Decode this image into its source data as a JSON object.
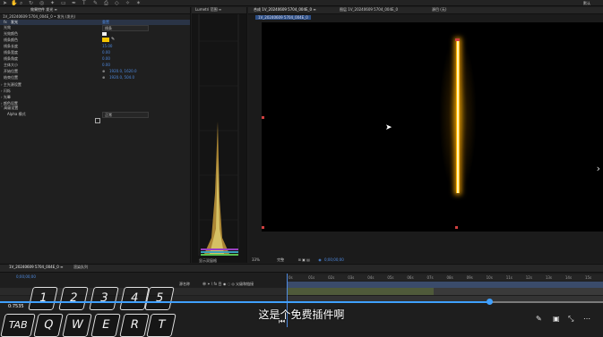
{
  "toolbar": {
    "right_label": "默认"
  },
  "effect_controls": {
    "tab_label": "效果控件 发光 ≡",
    "layer_path": "1V_20240609 5704_004E_0 • 发光 (发光)",
    "effect_name": "发光",
    "reset_label": "重置",
    "properties": [
      {
        "label": "光效",
        "value": "线条"
      },
      {
        "label": "光效颜色",
        "value": ""
      },
      {
        "label": "线条颜色",
        "value": ""
      },
      {
        "label": "线条长度",
        "value": "15.00"
      },
      {
        "label": "线条宽度",
        "value": "0.00"
      },
      {
        "label": "线条角度",
        "value": "0.00"
      },
      {
        "label": "主体大小",
        "value": "0.00"
      },
      {
        "label": "开始位置",
        "value": "1920.0, 1620.0"
      },
      {
        "label": "结束位置",
        "value": "1920.0, 504.0"
      }
    ],
    "groups": [
      "主光源设置",
      "闪烁",
      "光晕",
      "颜色设置",
      "高级设置"
    ],
    "alpha_label": "Alpha 模式",
    "alpha_value": "正常"
  },
  "scope": {
    "tab_label": "Lumetri 范围 ≡",
    "footer": "显示双窗格"
  },
  "composition": {
    "tab_label": "合成 1V_20240609 5704_004E_0 ≡",
    "layer_tab": "图层 1V_20240609 5704_004E_0",
    "extra_tab": "源目 (无)",
    "comp_chip": "1V_20240609 5704_004E_0",
    "zoom": "33%",
    "quality": "完整",
    "timecode": "0;00;00;00"
  },
  "timeline": {
    "tab_label": "1V_20240609 5704_004E_0 ≡",
    "render_tab": "渲染队列",
    "timecode": "0;00;00;00",
    "ruler": [
      "0s",
      "01s",
      "02s",
      "03s",
      "04s",
      "05s",
      "06s",
      "07s",
      "08s",
      "09s",
      "10s",
      "11s",
      "12s",
      "13s",
      "14s",
      "15s"
    ],
    "column_headers": [
      "源名称",
      "单 ✶ \\ fx 目 ◉ ◌ ◎ 父级和链接"
    ]
  },
  "overlay": {
    "keys_row1": [
      "1",
      "2",
      "3",
      "4",
      "5"
    ],
    "keys_row2": [
      "TAB",
      "Q",
      "W",
      "E",
      "R",
      "T"
    ],
    "elapsed": "0:7535"
  },
  "subtitle": "这是个免费插件啊",
  "colors": {
    "accent": "#4e8ae0",
    "glow": "#ffc400",
    "viewer_bg": "#000000"
  }
}
